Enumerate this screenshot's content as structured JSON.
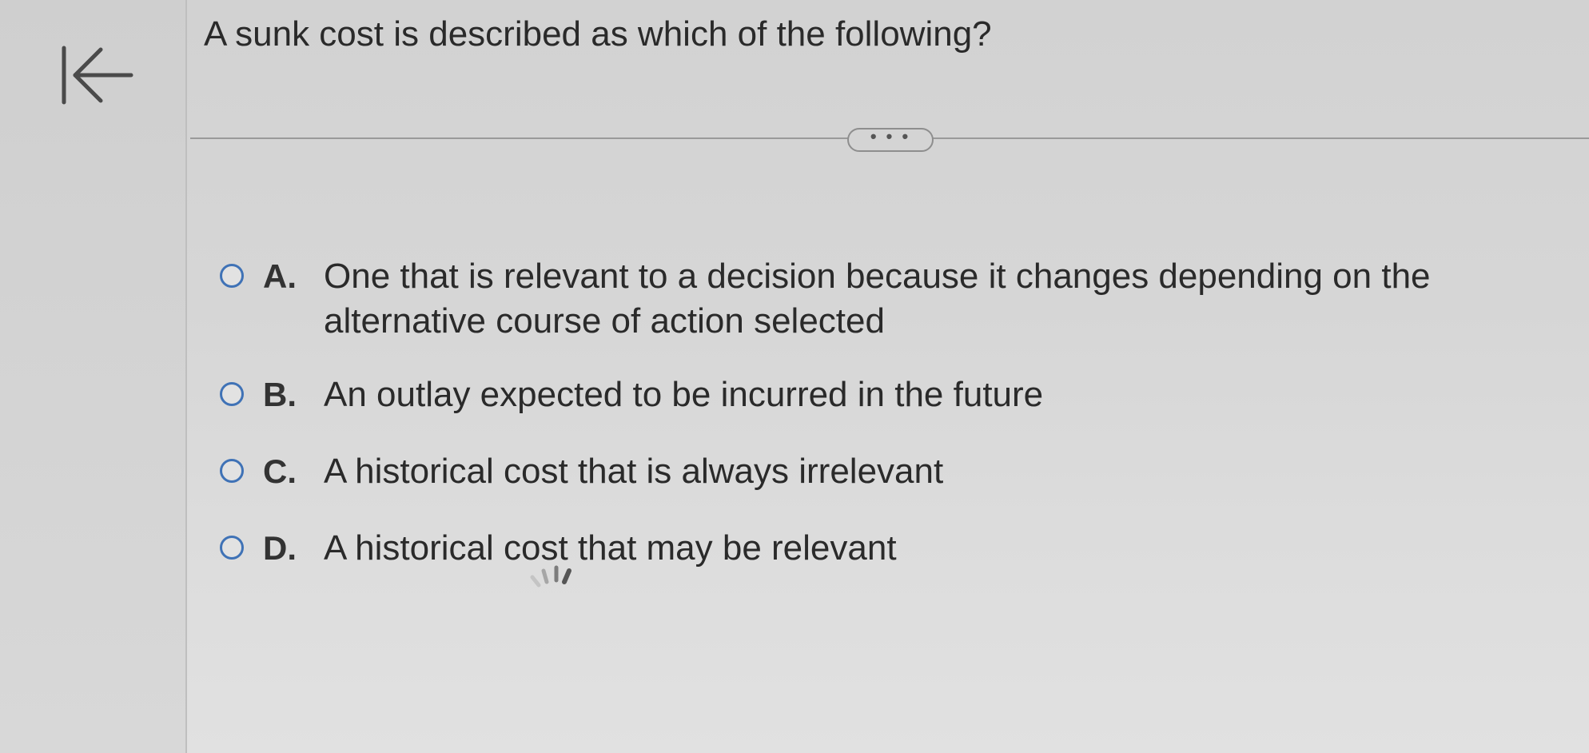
{
  "question": {
    "text": "A sunk cost is described as which of the following?"
  },
  "more_button": {
    "label": "• • •"
  },
  "options": [
    {
      "letter": "A.",
      "text": "One that is relevant to a decision because it changes depending on the alternative course of action selected"
    },
    {
      "letter": "B.",
      "text": "An outlay expected to be incurred in the future"
    },
    {
      "letter": "C.",
      "text": "A historical cost that is always irrelevant"
    },
    {
      "letter": "D.",
      "text": "A historical cost that may be relevant"
    }
  ],
  "icons": {
    "back": "back-to-start-icon",
    "loading": "loading-spinner-icon"
  },
  "colors": {
    "radio_border": "#3f72b6",
    "background": "#d6d6d6"
  }
}
